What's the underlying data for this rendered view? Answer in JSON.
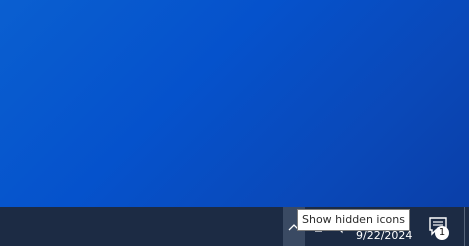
{
  "tooltip": {
    "text": "Show hidden icons"
  },
  "tray": {
    "chevron_icon": "chevron-up-icon",
    "network_icon": "network-icon",
    "volume_icon": "volume-icon"
  },
  "clock": {
    "date": "9/22/2024"
  },
  "notifications": {
    "icon": "action-center-icon",
    "count": "1"
  },
  "colors": {
    "taskbar": "#1c2b44",
    "desktop": "#0552cc",
    "tooltip_bg": "#ffffff"
  }
}
